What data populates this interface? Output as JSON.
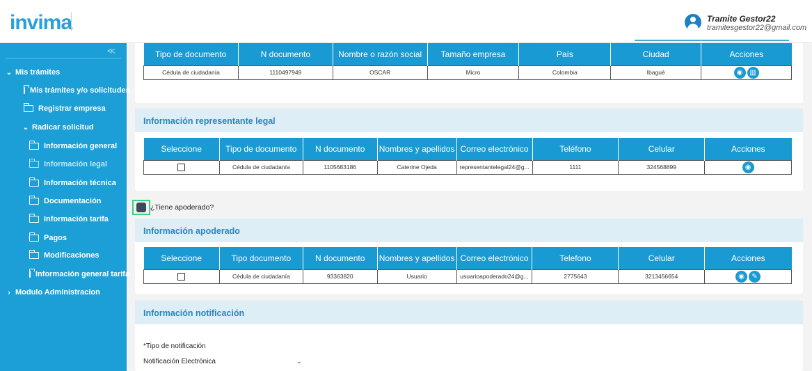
{
  "header": {
    "logo": "invima",
    "user_name": "Tramite Gestor22",
    "user_email": "tramitesgestor22@gmail.com"
  },
  "sidebar": {
    "collapse_icon": "≪",
    "items": [
      {
        "label": "Mis trámites",
        "icon": "chevron-down-icon"
      },
      {
        "label": "Mis trámites y/o solicitudes",
        "icon": "folder-icon"
      },
      {
        "label": "Registrar empresa",
        "icon": "folder-icon"
      },
      {
        "label": "Radicar solicitud",
        "icon": "chevron-down-icon"
      },
      {
        "label": "Información general",
        "icon": "folder-icon"
      },
      {
        "label": "Información legal",
        "icon": "folder-icon",
        "active": true
      },
      {
        "label": "Información técnica",
        "icon": "folder-icon"
      },
      {
        "label": "Documentación",
        "icon": "folder-icon"
      },
      {
        "label": "Información tarifa",
        "icon": "folder-icon"
      },
      {
        "label": "Pagos",
        "icon": "folder-icon"
      },
      {
        "label": "Modificaciones",
        "icon": "folder-icon"
      },
      {
        "label": "Información general tarifa",
        "icon": "folder-icon"
      },
      {
        "label": "Modulo Administracion",
        "icon": "chevron-right-icon"
      }
    ]
  },
  "empresa_table": {
    "headers": [
      "Tipo de documento",
      "N documento",
      "Nombre o razón social",
      "Tamaño empresa",
      "País",
      "Ciudad",
      "Acciones"
    ],
    "rows": [
      [
        "Cédula de ciudadanía",
        "1110497949",
        "OSCAR",
        "Micro",
        "Colombia",
        "Ibagué"
      ]
    ]
  },
  "representante": {
    "title": "Información representante legal",
    "headers": [
      "Seleccione",
      "Tipo de documento",
      "N documento",
      "Nombres y apellidos",
      "Correo electrónico",
      "Teléfono",
      "Celular",
      "Acciones"
    ],
    "rows": [
      [
        "",
        "Cédula de ciudadanía",
        "1105683186",
        "Caterine Ojeda",
        "representantelegal24@g...",
        "1111",
        "324568899"
      ]
    ]
  },
  "apoderado_question": "¿Tiene apoderado?",
  "apoderado": {
    "title": "Información apoderado",
    "headers": [
      "Seleccione",
      "Tipo documento",
      "N documento",
      "Nombres y apellidos",
      "Correo electrónico",
      "Telefono",
      "Celular",
      "Acciones"
    ],
    "rows": [
      [
        "",
        "Cédula de ciudadanía",
        "93363820",
        "Usuario",
        "usuarioapoderado24@g...",
        "2775643",
        "3213456654"
      ]
    ]
  },
  "notificacion": {
    "title": "Información notificación",
    "tipo_label": "*Tipo de notificación",
    "tipo_value": "Notificación Electrónica"
  },
  "colors": {
    "accent": "#1a9ad2",
    "sidebar": "#1b9fd6",
    "section_header": "#ddeef7",
    "checkbox_highlight": "#3bd17d"
  }
}
